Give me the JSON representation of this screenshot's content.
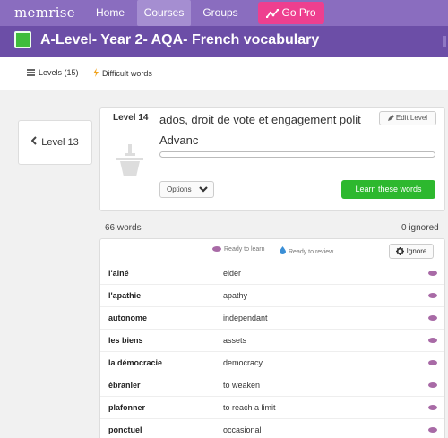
{
  "nav": {
    "logo": "memrise",
    "home": "Home",
    "courses": "Courses",
    "groups": "Groups",
    "gopro": "Go Pro"
  },
  "course": {
    "title": "A-Level- Year 2- AQA- French vocabulary",
    "badge_color": "#3fbd3b"
  },
  "subnav": {
    "levels": "Levels (15)",
    "difficult": "Difficult words"
  },
  "prev_level": {
    "label": "Level 13"
  },
  "level": {
    "number": "Level 14",
    "title": "ados, droit de vote et engagement polit",
    "subtitle": "Advanc",
    "edit_label": "Edit Level",
    "options_label": "Options",
    "learn_label": "Learn these words",
    "progress": 0.0
  },
  "counts": {
    "words": "66 words",
    "ignored": "0 ignored"
  },
  "legend": {
    "ready_learn": "Ready to learn",
    "ready_review": "Ready to review",
    "ignore": "Ignore"
  },
  "words": [
    {
      "fr": "l'aîné",
      "en": "elder"
    },
    {
      "fr": "l'apathie",
      "en": "apathy"
    },
    {
      "fr": "autonome",
      "en": "independant"
    },
    {
      "fr": "les biens",
      "en": "assets"
    },
    {
      "fr": "la démocracie",
      "en": "democracy"
    },
    {
      "fr": "ébranler",
      "en": "to weaken"
    },
    {
      "fr": "plafonner",
      "en": "to reach a limit"
    },
    {
      "fr": "ponctuel",
      "en": "occasional"
    }
  ],
  "colors": {
    "nav": "#8a6dbf",
    "course_bar": "#6c4ea7",
    "gopro": "#ee3f8f",
    "learn_button": "#2db82e",
    "seed": "#a86aa6",
    "review": "#3a8fd6"
  }
}
